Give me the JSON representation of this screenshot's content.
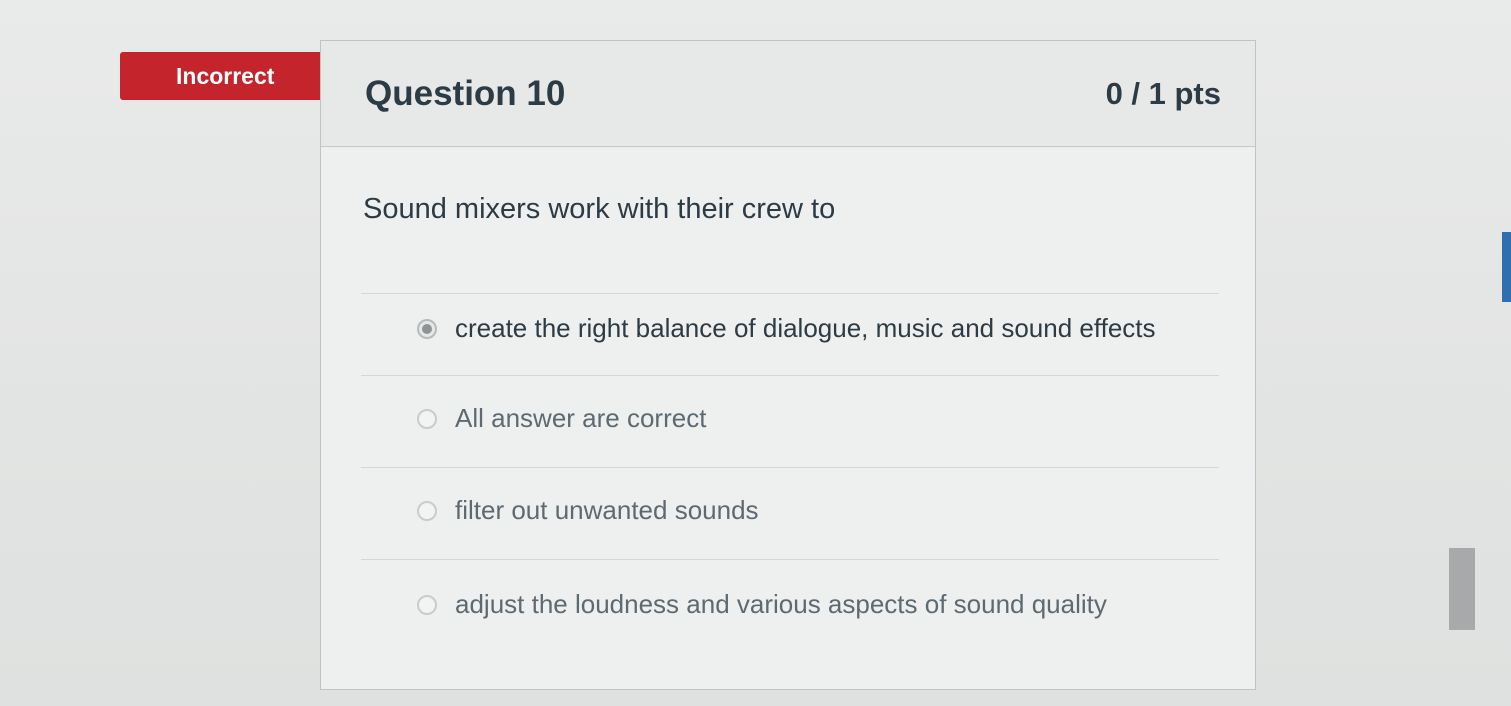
{
  "quiz": {
    "status_label": "Incorrect",
    "question_title": "Question 10",
    "points": "0 / 1 pts",
    "question_text": "Sound mixers work with their crew to",
    "answers": [
      {
        "label": "create the right balance of dialogue, music and sound effects",
        "selected": true
      },
      {
        "label": "All answer are correct",
        "selected": false
      },
      {
        "label": "filter out unwanted sounds",
        "selected": false
      },
      {
        "label": "adjust the loudness and various aspects of sound quality",
        "selected": false
      }
    ]
  },
  "colors": {
    "incorrect_badge": "#c4252d",
    "text": "#2d3b45",
    "accent_blue": "#2f6fb0"
  }
}
